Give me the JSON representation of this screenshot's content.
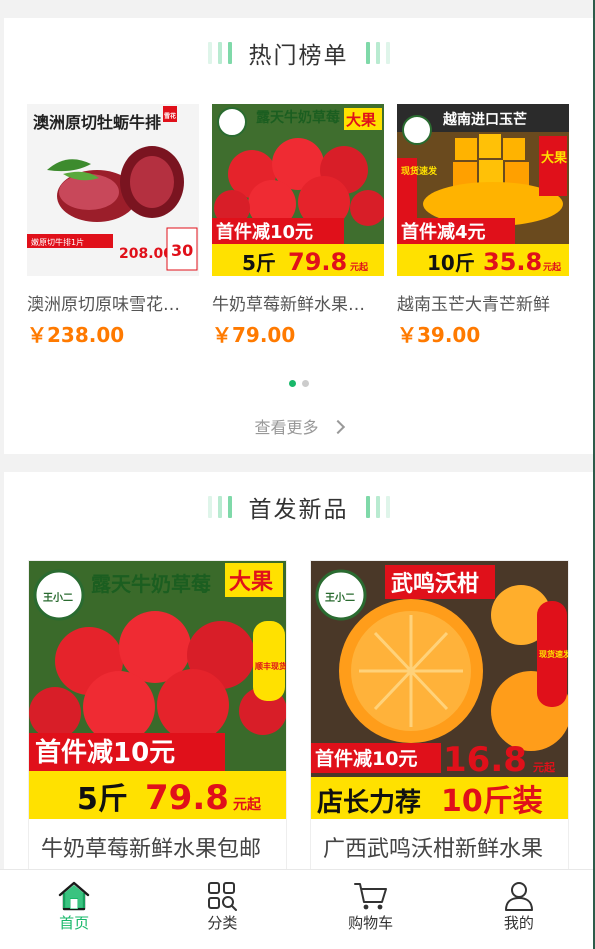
{
  "hot_section": {
    "title": "热门榜单",
    "more_label": "查看更多",
    "items": [
      {
        "name": "澳洲原切原味雪花牛排",
        "price": "￥238.00",
        "image_banner": "澳洲原切牡蛎牛排",
        "image_tag": "雪花",
        "image_caption": "嫩原切牛排1片",
        "image_promo_price": "208.00",
        "image_coupon": "30"
      },
      {
        "name": "牛奶草莓新鲜水果包邮",
        "price": "￥79.00",
        "image_banner": "露天牛奶草莓",
        "image_tag": "大果",
        "image_promo": "首件减10元",
        "image_weight": "5斤",
        "image_promo_price": "79.8",
        "image_unit": "元起"
      },
      {
        "name": "越南玉芒大青芒新鲜",
        "price": "￥39.00",
        "image_banner": "越南进口玉芒",
        "image_tag": "大果",
        "image_side": "现货速发",
        "image_promo": "首件减4元",
        "image_weight": "10斤",
        "image_promo_price": "35.8",
        "image_unit": "元起"
      }
    ],
    "pagination": {
      "pages": 2,
      "current": 1
    }
  },
  "new_section": {
    "title": "首发新品",
    "items": [
      {
        "name": "牛奶草莓新鲜水果包邮",
        "image_banner": "露天牛奶草莓",
        "image_tag": "大果",
        "image_side": "顺丰现货速发",
        "image_promo": "首件减10元",
        "image_weight": "5斤",
        "image_promo_price": "79.8",
        "image_unit": "元起",
        "image_brand": "王小二"
      },
      {
        "name": "广西武鸣沃柑新鲜水果",
        "image_banner": "武鸣沃柑",
        "image_side": "现货速发",
        "image_promo": "首件减10元",
        "image_promo_price": "16.8",
        "image_unit": "元起",
        "image_slogan": "店长力荐",
        "image_weight": "10斤装",
        "image_brand": "王小二"
      }
    ]
  },
  "tabbar": {
    "items": [
      {
        "label": "首页",
        "icon": "home-icon",
        "active": true
      },
      {
        "label": "分类",
        "icon": "category-grid-icon",
        "active": false
      },
      {
        "label": "购物车",
        "icon": "cart-icon",
        "active": false
      },
      {
        "label": "我的",
        "icon": "user-icon",
        "active": false
      }
    ]
  },
  "colors": {
    "accent": "#18b86a",
    "price": "#ff7a00",
    "promo_red": "#e0101a",
    "promo_yellow": "#ffe100"
  }
}
